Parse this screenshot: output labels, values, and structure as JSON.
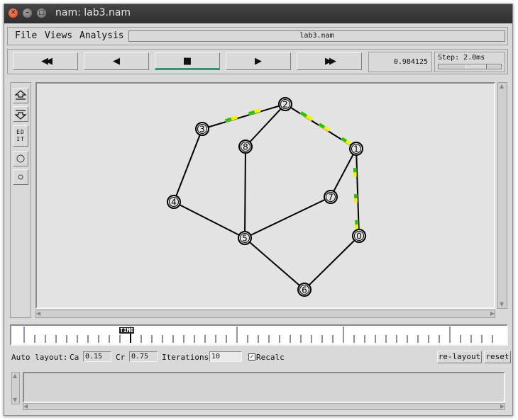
{
  "window": {
    "title": "nam: lab3.nam"
  },
  "menu": {
    "file": "File",
    "views": "Views",
    "analysis": "Analysis"
  },
  "file_name": "lab3.nam",
  "playback": {
    "rewind_icon": "◀◀",
    "back_icon": "◀",
    "stop_icon": "■",
    "play_icon": "▶",
    "fast_forward_icon": "▶▶",
    "time": "0.984125",
    "step_label": "Step: 2.0ms"
  },
  "tools": {
    "edit_label": "EDIT"
  },
  "network": {
    "nodes": [
      {
        "id": "0"
      },
      {
        "id": "1"
      },
      {
        "id": "2"
      },
      {
        "id": "3"
      },
      {
        "id": "4"
      },
      {
        "id": "5"
      },
      {
        "id": "6"
      },
      {
        "id": "7"
      },
      {
        "id": "8"
      }
    ],
    "links": [
      [
        "2",
        "3"
      ],
      [
        "2",
        "1"
      ],
      [
        "2",
        "8"
      ],
      [
        "3",
        "4"
      ],
      [
        "4",
        "5"
      ],
      [
        "8",
        "5"
      ],
      [
        "5",
        "7"
      ],
      [
        "7",
        "1"
      ],
      [
        "1",
        "0"
      ],
      [
        "5",
        "6"
      ],
      [
        "6",
        "0"
      ]
    ]
  },
  "timeline": {
    "marker_label": "TIME"
  },
  "auto_layout": {
    "label": "Auto layout:",
    "ca_label": "Ca",
    "ca_value": "0.15",
    "cr_label": "Cr",
    "cr_value": "0.75",
    "iterations_label": "Iterations",
    "iterations_value": "10",
    "recalc_label": "Recalc",
    "recalc_checked": true,
    "relayout_label": "re-layout",
    "reset_label": "reset"
  },
  "colors": {
    "packet_green": "#22c11f",
    "packet_yellow": "#f2f20a",
    "stop_indicator": "#3f8f77"
  }
}
